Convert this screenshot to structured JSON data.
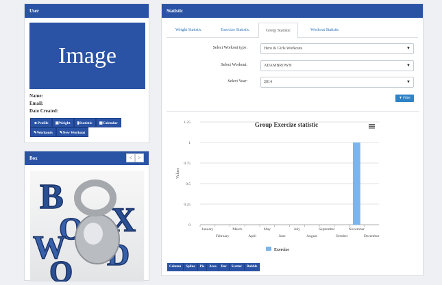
{
  "user_panel": {
    "title": "User",
    "image_text": "Image",
    "name_label": "Name:",
    "email_label": "Email:",
    "date_label": "Date Created:",
    "buttons": [
      "Profile",
      "Weight",
      "Statistic",
      "Calendar",
      "Workouts",
      "New Workout"
    ]
  },
  "box_panel": {
    "title": "Box",
    "prev_label": "<",
    "next_label": ">",
    "logo_text": "BOX WOD"
  },
  "stat_panel": {
    "title": "Statistic",
    "tabs": [
      "Weight Statistic",
      "Exercize Statistic",
      "Group Statistic",
      "Workout Statistic"
    ],
    "active_tab": "Group Statistic",
    "type_label": "Select Workout type:",
    "type_value": "Hero & Girls Workouts",
    "workout_label": "Select Workout:",
    "workout_value": "ADAMBROWN",
    "year_label": "Select Year:",
    "year_value": "2014",
    "filter_label": "Filter",
    "series_buttons": [
      "Column",
      "Spline",
      "Pie",
      "Area",
      "Bar",
      "Scatter",
      "Bubble"
    ]
  },
  "chart_data": {
    "type": "bar",
    "title": "Group Exercize statistic",
    "ylabel": "Values",
    "xlabel": "",
    "ylim": [
      0,
      1.25
    ],
    "yticks": [
      "0",
      "0.25",
      "0.5",
      "0.75",
      "1",
      "1.25"
    ],
    "categories": [
      "January",
      "February",
      "March",
      "April",
      "May",
      "June",
      "July",
      "August",
      "September",
      "October",
      "November",
      "December"
    ],
    "series": [
      {
        "name": "Exercize",
        "values": [
          0,
          0,
          0,
          0,
          0,
          0,
          0,
          0,
          0,
          0,
          1,
          0
        ],
        "color": "#7cb5ec"
      }
    ],
    "legend": "bottom-center"
  }
}
